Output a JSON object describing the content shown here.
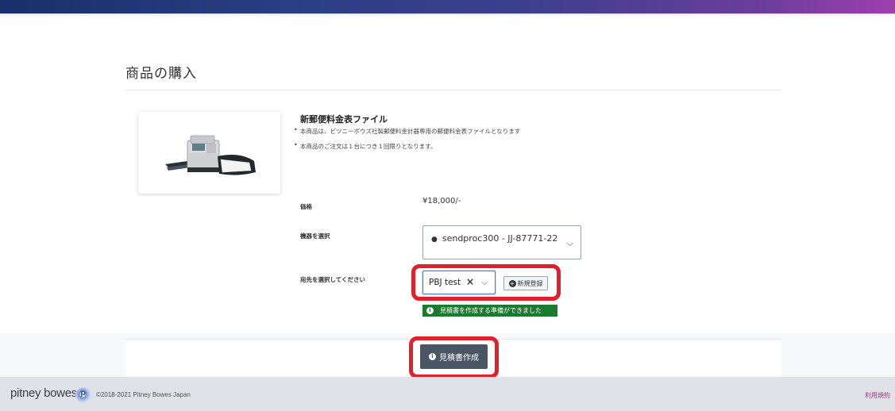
{
  "header": {
    "gradient_colors": [
      "#19306b",
      "#3e3f8f",
      "#9d3fb0"
    ]
  },
  "page": {
    "title": "商品の購入"
  },
  "product": {
    "name": "新郵便料金表ファイル",
    "bullets": [
      "本商品は、ピツニーボウズ社製郵便料金計器専用の郵便料金表ファイルとなります",
      "本商品のご注文は１台につき１回限りとなります。"
    ],
    "image_icon": "postage-meter-icon"
  },
  "form": {
    "price_label": "価格",
    "price_value": "¥18,000/-",
    "machine_label": "機器を選択",
    "machine_selected": "sendproc300 - JJ-87771-22",
    "recipient_label": "宛先を選択してください",
    "recipient_selected": "PBJ test",
    "new_register_label": "新規登録",
    "status_message": "見積書を作成する準備ができました"
  },
  "actions": {
    "create_quote_label": "見積書作成"
  },
  "footer": {
    "brand": "pitney bowes",
    "logo_letter": "p",
    "copyright": "©2018-2021 Pitney Bowes Japan",
    "terms_link": "利用規約"
  },
  "colors": {
    "highlight": "#e0202b",
    "status_green": "#1a7a2e",
    "button_dark": "#4a5664",
    "footer_bg": "#dfe2e7",
    "terms_link": "#a03a8a"
  }
}
